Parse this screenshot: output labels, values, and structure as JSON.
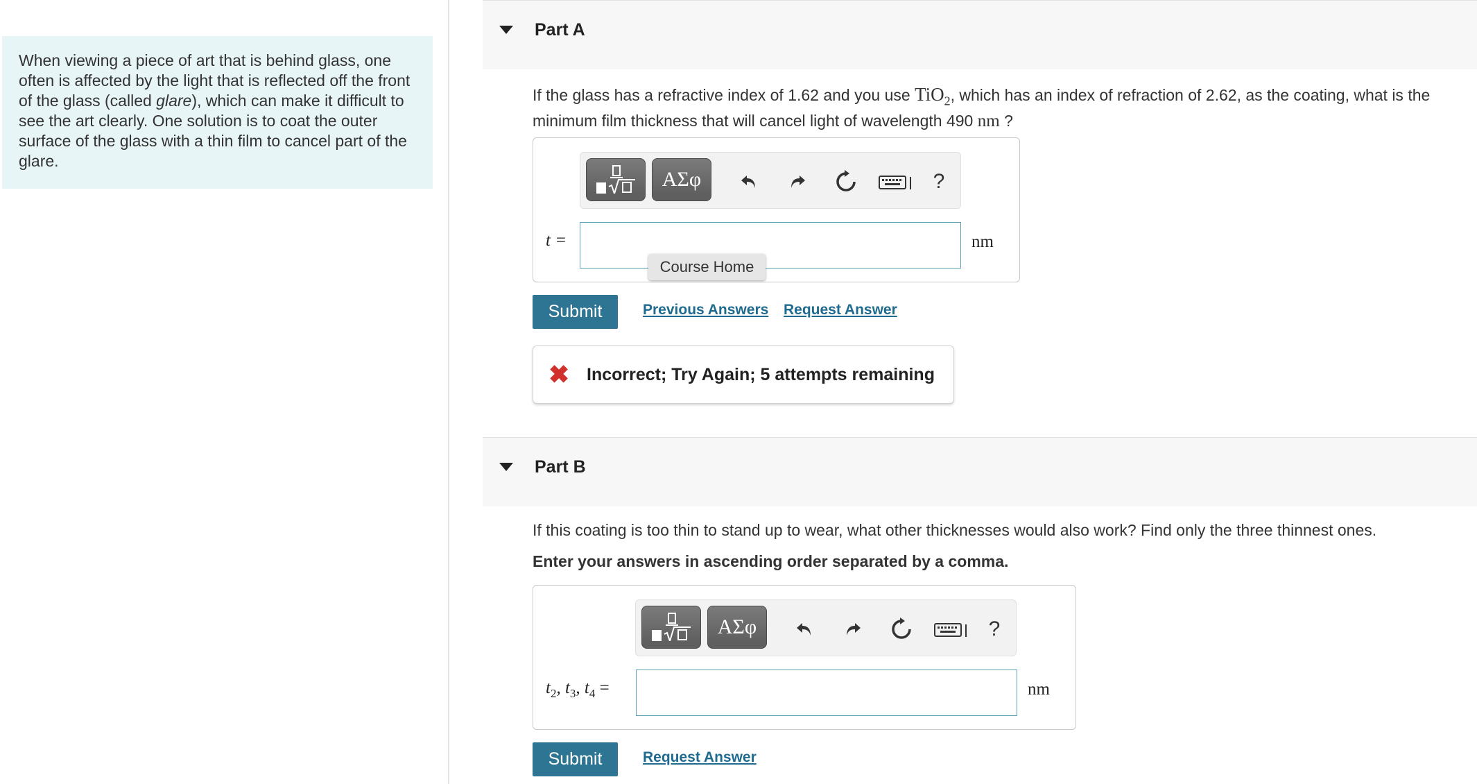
{
  "intro": {
    "segments": [
      "When viewing a piece of art that is behind glass, one often is affected by the light that is reflected off the front of the glass (called ",
      "glare",
      "), which can make it difficult to see the art clearly. One solution is to coat the outer surface of the glass with a thin film to cancel part of the glare."
    ]
  },
  "partA": {
    "title": "Part A",
    "question": {
      "pre": "If the glass has a refractive index of 1.62 and you use ",
      "formula": "TiO",
      "formula_sub": "2",
      "mid": ", which has an index of refraction of 2.62, as the coating, what is the minimum film thickness that will cancel light of wavelength 490 ",
      "unit": "nm",
      "post": " ?"
    },
    "toolbar": {
      "templates_icon": "fraction-root-icon",
      "greek_label": "ΑΣφ",
      "undo_icon": "undo-icon",
      "redo_icon": "redo-icon",
      "reset_icon": "reset-icon",
      "keyboard_icon": "keyboard-icon",
      "help_label": "?"
    },
    "label": "t =",
    "input_value": "",
    "unit": "nm",
    "submit": "Submit",
    "previous_answers": "Previous Answers",
    "request_answer": "Request Answer",
    "feedback": "Incorrect; Try Again; 5 attempts remaining"
  },
  "tooltip": "Course Home",
  "partB": {
    "title": "Part B",
    "question": "If this coating is too thin to stand up to wear, what other thicknesses would also work? Find only the three thinnest ones.",
    "instruction": "Enter your answers in ascending order separated by a comma.",
    "toolbar": {
      "greek_label": "ΑΣφ",
      "help_label": "?"
    },
    "label": {
      "t": "t",
      "s2": "2",
      "s3": "3",
      "s4": "4",
      "sep": ", ",
      "eq": " ="
    },
    "input_value": "",
    "unit": "nm",
    "submit": "Submit",
    "request_answer": "Request Answer"
  },
  "colors": {
    "accent": "#2d7592",
    "link": "#1f6b8f",
    "error": "#d0312d",
    "intro_bg": "#e8f5f7"
  }
}
